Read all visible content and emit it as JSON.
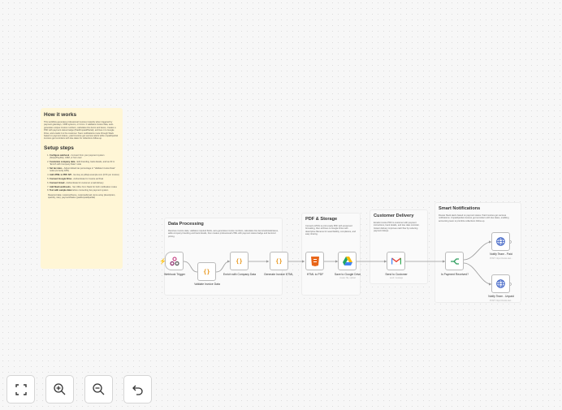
{
  "sticky": {
    "title": "How it works",
    "description": "This workflow generates professional invoices instantly when triggered by payment gateways, CRM systems, or forms. It validates invoice data, auto-generates unique invoice numbers, calculates line items and taxes, creates a PDF with payment status badge (Paid/Unpaid/Partial), archives it to Google Drive, and emails it to the customer. Team notifications route through Slack based on payment status—paid invoices get success alerts while unpaid/partial invoices get reminders with due dates for collections follow-up.",
    "setup_title": "Setup steps",
    "steps": [
      {
        "bold": "Configure webhook",
        "text": " - Connect from your payment system (Stripe/PayPal), CRM, or form tool"
      },
      {
        "bold": "Customize company data",
        "text": " - Edit branding, bank details, and tax ID in \"Enrich with Company Data\" node"
      },
      {
        "bold": "Set tax rates",
        "text": " - Adjust default tax percentage in \"Validate Invoice Data\" node (currently 18%)"
      },
      {
        "bold": "Add HTML to PDF API",
        "text": " - Get key at pdfapi.example.com (0.5¢ per invoice)"
      },
      {
        "bold": "Connect Google Drive",
        "text": " - Authenticate for invoice archival"
      },
      {
        "bold": "Connect Gmail",
        "text": " - Authenticate for customer email delivery"
      },
      {
        "bold": "Add Slack webhooks",
        "text": " - Set URLs from Slack for both notification routes"
      },
      {
        "bold": "Test with sample data",
        "text": " before connecting live payment system"
      }
    ],
    "required": "Required data: customerName, customerEmail, items array (description, quantity, rate), paymentStatus (paid/unpaid/partial)"
  },
  "sections": {
    "data_processing": {
      "title": "Data Processing",
      "text": "Receives invoice data, validates required fields, auto-generates invoice numbers, calculates line items/subtotals/taxes, adds company branding and bank details, then creates professional HTML with payment status badge and itemized pricing."
    },
    "pdf_storage": {
      "title": "PDF & Storage",
      "text": "Converts HTML to print-ready PDF with preserved formatting, then archives to Google Drive with descriptive filename for searchability, compliance, and easy sharing."
    },
    "delivery": {
      "title": "Customer Delivery",
      "text": "Emails invoice PDF to customer with payment instructions, bank details, and due date reminder. Instant delivery improves cash flow by reducing payment delays."
    },
    "notifications": {
      "title": "Smart Notifications",
      "text": "Routes Slack alerts based on payment status. Paid invoices get success notifications. Unpaid/partial invoices get reminders with due dates, enabling accounting team to prioritize collections follow-up."
    }
  },
  "nodes": {
    "webhook": "Webhook Trigger",
    "validate": "Validate Invoice Data",
    "enrich": "Enrich with Company Data",
    "generate": "Generate Invoice HTML",
    "html_pdf": "HTML to PDF",
    "drive": "Save to Google Drive",
    "drive_sub": "create: file, upload",
    "email": "Send to Customer",
    "email_sub": "send: message",
    "if": "Is Payment Received?",
    "notify_paid": "Notify Team - Paid",
    "notify_paid_sub": "POST: https://hooks.slac...",
    "notify_unpaid": "Notify Team - Unpaid",
    "notify_unpaid_sub": "POST: https://hooks.slac..."
  },
  "icons": {
    "webhook": "webhook-icon",
    "code": "code-icon",
    "html": "html-icon",
    "drive": "google-drive-icon",
    "gmail": "gmail-icon",
    "if": "if-branch-icon",
    "http": "globe-icon"
  },
  "controls": [
    "fit-to-view",
    "zoom-in",
    "zoom-out",
    "undo"
  ],
  "colors": {
    "sticky": "#fff6d6",
    "accent": "#e8961a",
    "link": "#ff6d5a",
    "globe": "#3a5fc4"
  }
}
